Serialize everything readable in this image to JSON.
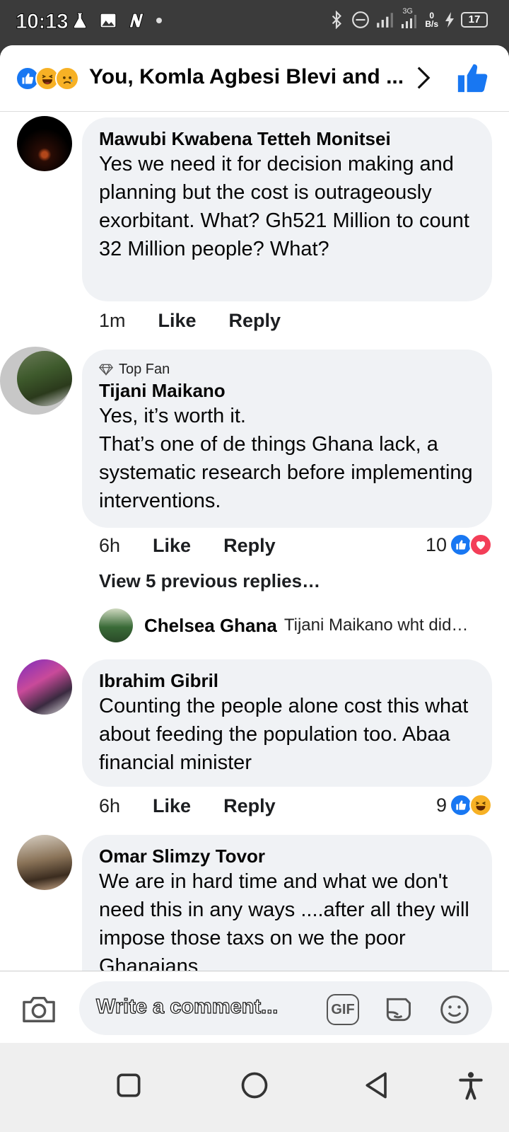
{
  "status_bar": {
    "time": "10:13",
    "network": "3G",
    "net_speed_value": "0",
    "net_speed_unit": "B/s",
    "battery": "17"
  },
  "header": {
    "title": "You, Komla Agbesi Blevi and ...",
    "reactions": [
      "like-icon",
      "haha-icon",
      "sad-icon"
    ]
  },
  "comments": [
    {
      "author": "Mawubi Kwabena Tetteh Monitsei",
      "text": "Yes we need it for decision making and planning but the cost is outrageously exorbitant. What? Gh521 Million to count 32 Million people? What?",
      "time": "1m",
      "like_label": "Like",
      "reply_label": "Reply"
    },
    {
      "badge": "Top Fan",
      "author": "Tijani Maikano",
      "text_lines": [
        "Yes, it’s worth it.",
        "That’s one of de things Ghana lack, a systematic research before implementing interventions."
      ],
      "time": "6h",
      "like_label": "Like",
      "reply_label": "Reply",
      "reaction_count": "10",
      "view_previous": "View 5 previous replies…",
      "reply_preview": {
        "author": "Chelsea Ghana",
        "text": "Tijani Maikano   wht did…"
      }
    },
    {
      "author": "Ibrahim Gibril",
      "text": "Counting the people alone cost this what about feeding the population too. Abaa financial minister",
      "time": "6h",
      "like_label": "Like",
      "reply_label": "Reply",
      "reaction_count": "9"
    },
    {
      "author": "Omar Slimzy Tovor",
      "text": "We are in hard time and what we don't need this in any ways ....after all they will impose those taxs on we the poor Ghanaians"
    }
  ],
  "composer": {
    "placeholder": "Write a comment...",
    "gif_label": "GIF"
  },
  "colors": {
    "facebook_blue": "#1877f2",
    "bubble_bg": "#f0f2f5",
    "love_red": "#f33e58",
    "haha_yellow": "#f7b125"
  }
}
